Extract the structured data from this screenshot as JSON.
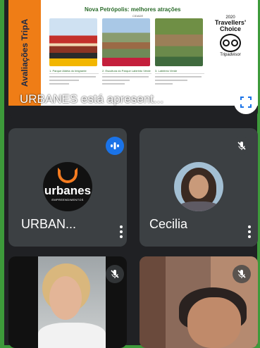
{
  "presentation": {
    "side_text": "Avaliações TripA",
    "slide_title": "Nova Petrópolis: melhores atrações",
    "slide_subtitle": "CIDADE",
    "photo_numbers": [
      "1. Parque Aldeia do Imigrante",
      "2. Escultura do Parque Labirinto Verde",
      "3. Labirinto Verde"
    ],
    "award_year": "2020",
    "award_line1": "Travellers'",
    "award_line2": "Choice",
    "award_brand": "Tripadvisor",
    "label": "URBANES está apresent...",
    "fullscreen_icon": "fullscreen-icon"
  },
  "participants": [
    {
      "name": "URBAN...",
      "mic": "speaking",
      "avatar": "urbanes",
      "logo_text": "urbanes",
      "logo_tagline": "EMPREENDIMENTOS"
    },
    {
      "name": "Cecilia",
      "mic": "muted",
      "avatar": "photo"
    },
    {
      "name": "",
      "mic": "muted",
      "avatar": "video"
    },
    {
      "name": "",
      "mic": "muted",
      "avatar": "video"
    }
  ],
  "colors": {
    "accent": "#1a73e8",
    "tile": "#3c4043",
    "background": "#202124",
    "frame": "#3d9a3a",
    "brand_orange": "#ef7d16"
  }
}
